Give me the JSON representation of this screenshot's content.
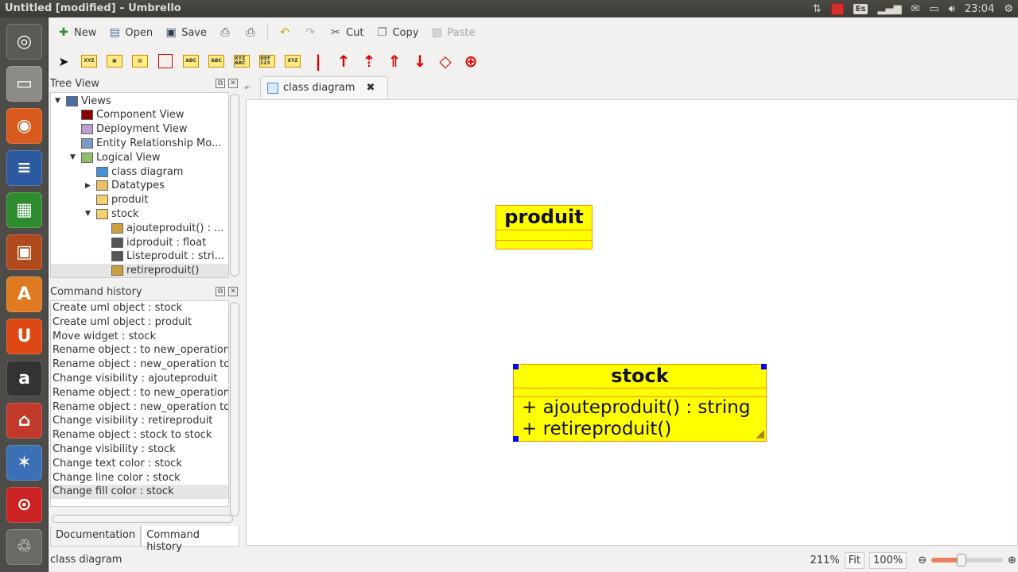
{
  "window_title": "Untitled [modified] – Umbrello",
  "tray": {
    "keyboard_layout": "Es",
    "time": "23:04"
  },
  "launcher": [
    {
      "name": "ubuntu-dash",
      "color": "#5b5a56",
      "glyph": "◎"
    },
    {
      "name": "files",
      "color": "#8d8b86",
      "glyph": "▭"
    },
    {
      "name": "firefox",
      "color": "#d85a1c",
      "glyph": "◉"
    },
    {
      "name": "writer",
      "color": "#2c5aa0",
      "glyph": "≡"
    },
    {
      "name": "calc",
      "color": "#2e8b2e",
      "glyph": "▦"
    },
    {
      "name": "impress",
      "color": "#b04a1c",
      "glyph": "▣"
    },
    {
      "name": "software-center",
      "color": "#e07a20",
      "glyph": "A"
    },
    {
      "name": "ubuntu-one",
      "color": "#dd4814",
      "glyph": "U"
    },
    {
      "name": "amazon",
      "color": "#333333",
      "glyph": "a"
    },
    {
      "name": "umbrello",
      "color": "#c0392b",
      "glyph": "⌂"
    },
    {
      "name": "app-11",
      "color": "#3b6fb6",
      "glyph": "✶"
    },
    {
      "name": "app-12",
      "color": "#cc2222",
      "glyph": "⊙"
    },
    {
      "name": "trash",
      "color": "#6a6965",
      "glyph": "♲"
    }
  ],
  "toolbar": {
    "new_label": "New",
    "open_label": "Open",
    "save_label": "Save",
    "cut_label": "Cut",
    "copy_label": "Copy",
    "paste_label": "Paste"
  },
  "diagram_tools": [
    {
      "name": "select-arrow-tool",
      "kind": "cursor",
      "text": "➤"
    },
    {
      "name": "class-tool",
      "kind": "mini",
      "text": "XYZ"
    },
    {
      "name": "package-tool",
      "kind": "mini",
      "text": "▣"
    },
    {
      "name": "note-tool",
      "kind": "mini",
      "text": "▤"
    },
    {
      "name": "box-tool",
      "kind": "box",
      "text": ""
    },
    {
      "name": "interface-tool",
      "kind": "mini",
      "text": "ABC"
    },
    {
      "name": "datatype-tool",
      "kind": "mini",
      "text": "ABC"
    },
    {
      "name": "enum-tool",
      "kind": "mini",
      "text": "XYZ ABC"
    },
    {
      "name": "entity-tool",
      "kind": "mini",
      "text": "DEF 123"
    },
    {
      "name": "template-tool",
      "kind": "mini",
      "text": "XYZ"
    },
    {
      "name": "association-tool",
      "kind": "arr",
      "text": "|"
    },
    {
      "name": "directed-association-tool",
      "kind": "arr",
      "text": "↑"
    },
    {
      "name": "dependency-tool",
      "kind": "arr",
      "text": "⇡"
    },
    {
      "name": "generalization-tool",
      "kind": "arr",
      "text": "⇑"
    },
    {
      "name": "aggregation-tool",
      "kind": "arr",
      "text": "↓"
    },
    {
      "name": "composition-tool",
      "kind": "arr",
      "text": "◇"
    },
    {
      "name": "containment-tool",
      "kind": "arr",
      "text": "⊕"
    }
  ],
  "tree_view": {
    "title": "Tree View",
    "items": [
      {
        "label": "Views",
        "indent": 0,
        "expander": "▼",
        "icon": "#4a6fa5"
      },
      {
        "label": "Component View",
        "indent": 1,
        "expander": "",
        "icon": "#8b0000"
      },
      {
        "label": "Deployment View",
        "indent": 1,
        "expander": "",
        "icon": "#b7a0d0"
      },
      {
        "label": "Entity Relationship Mo...",
        "indent": 1,
        "expander": "",
        "icon": "#7a9ac8"
      },
      {
        "label": "Logical View",
        "indent": 1,
        "expander": "▼",
        "icon": "#8fbf6a"
      },
      {
        "label": "class diagram",
        "indent": 2,
        "expander": "",
        "icon": "#4a90d9"
      },
      {
        "label": "Datatypes",
        "indent": 2,
        "expander": "▶",
        "icon": "#e8c060"
      },
      {
        "label": "produit",
        "indent": 2,
        "expander": "",
        "icon": "#f2d070"
      },
      {
        "label": "stock",
        "indent": 2,
        "expander": "▼",
        "icon": "#f2d070"
      },
      {
        "label": "ajouteproduit() : ...",
        "indent": 3,
        "expander": "",
        "icon": "#c8a040"
      },
      {
        "label": "idproduit : float",
        "indent": 3,
        "expander": "",
        "icon": "#555555"
      },
      {
        "label": "Listeproduit : stri...",
        "indent": 3,
        "expander": "",
        "icon": "#555555"
      },
      {
        "label": "retireproduit()",
        "indent": 3,
        "expander": "",
        "icon": "#c8a040"
      }
    ]
  },
  "command_history": {
    "title": "Command history",
    "items": [
      "Create uml object : stock",
      "Create uml object : produit",
      "Move widget : stock",
      "Rename object :  to new_operation",
      "Rename object : new_operation to a",
      "Change visibility : ajouteproduit",
      "Rename object :  to new_operation",
      "Rename object : new_operation to r",
      "Change visibility : retireproduit",
      "Rename object : stock to stock",
      "Change visibility : stock",
      "Change text color : stock",
      "Change line color : stock",
      "Change fill color : stock"
    ]
  },
  "dock_tabs": [
    "Documentation",
    "Command history"
  ],
  "diagram_tab": {
    "label": "class diagram"
  },
  "diagram": {
    "fill_color": "#ffff00",
    "line_color": "#ff8c00",
    "classes": [
      {
        "name": "produit",
        "operations": []
      },
      {
        "name": "stock",
        "operations": [
          "+ ajouteproduit() : string",
          "+ retireproduit()"
        ]
      }
    ]
  },
  "status": {
    "message": "class diagram",
    "zoom_text": "211%",
    "fit_label": "Fit",
    "reset_label": "100%",
    "zoom_slider": 0.42
  }
}
